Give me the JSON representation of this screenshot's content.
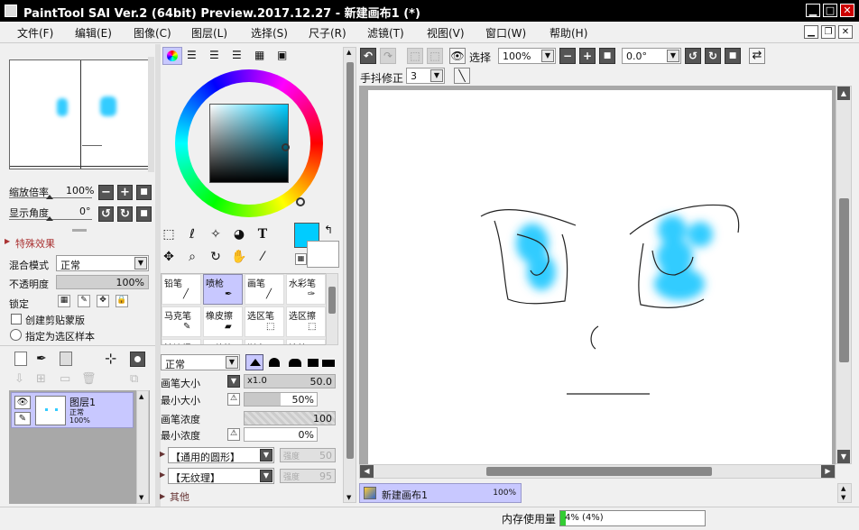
{
  "window": {
    "title": "PaintTool SAI Ver.2 (64bit) Preview.2017.12.27 - 新建画布1 (*)"
  },
  "menu": [
    "文件(F)",
    "编辑(E)",
    "图像(C)",
    "图层(L)",
    "选择(S)",
    "尺子(R)",
    "滤镜(T)",
    "视图(V)",
    "窗口(W)",
    "帮助(H)"
  ],
  "navigator": {
    "zoom_label": "缩放倍率",
    "zoom_value": "100%",
    "angle_label": "显示角度",
    "angle_value": "0°"
  },
  "effects": {
    "header": "特殊效果"
  },
  "layer_props": {
    "blend_label": "混合模式",
    "blend_value": "正常",
    "opacity_label": "不透明度",
    "opacity_value": "100%",
    "lock_label": "锁定",
    "clip_label": "创建剪贴蒙版",
    "sample_label": "指定为选区样本"
  },
  "layers": [
    {
      "name": "图层1",
      "mode": "正常",
      "opacity": "100%"
    }
  ],
  "brushes": [
    {
      "name": "铅笔"
    },
    {
      "name": "喷枪"
    },
    {
      "name": "画笔"
    },
    {
      "name": "水彩笔"
    },
    {
      "name": "马克笔"
    },
    {
      "name": "橡皮擦"
    },
    {
      "name": "选区笔"
    },
    {
      "name": "选区擦"
    },
    {
      "name": "油漆桶"
    },
    {
      "name": "二值笔"
    },
    {
      "name": "渐变"
    },
    {
      "name": "涂抹"
    }
  ],
  "brush_settings": {
    "mode_value": "正常",
    "size_label": "画笔大小",
    "size_mult": "x1.0",
    "size_value": "50.0",
    "minsize_label": "最小大小",
    "minsize_value": "50%",
    "density_label": "画笔浓度",
    "density_value": "100",
    "mindensity_label": "最小浓度",
    "mindensity_value": "0%",
    "shape_value": "【通用的圆形】",
    "shape_strength_label": "强度",
    "shape_strength": "50",
    "texture_value": "【无纹理】",
    "texture_strength_label": "强度",
    "texture_strength": "95",
    "other_label": "其他"
  },
  "canvas_toolbar": {
    "select_label": "选择",
    "zoom_value": "100%",
    "angle_value": "0.0°",
    "stabilizer_label": "手抖修正",
    "stabilizer_value": "3"
  },
  "canvas_tab": {
    "name": "新建画布1",
    "zoom": "100%"
  },
  "status": {
    "memory_label": "内存使用量",
    "memory_value": "4% (4%)",
    "memory_fraction": 0.04
  },
  "colors": {
    "current": "#00ccff",
    "accent": "#c8c8ff"
  }
}
